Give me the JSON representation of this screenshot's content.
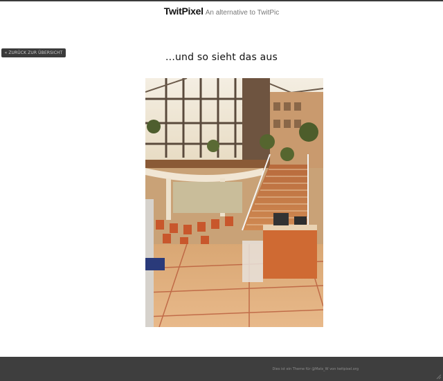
{
  "header": {
    "brand": "TwitPixel",
    "tagline": "An alternative to TwitPic"
  },
  "nav": {
    "back_label": "« ZURÜCK ZUR ÜBERSICHT"
  },
  "photo": {
    "title": "...und so sieht das aus"
  },
  "footer": {
    "credit": "Dies ist ein Theme für @Mats_W von twitpixel.org"
  },
  "colors": {
    "top_bar": "#3a3a3a",
    "footer_bg": "#3e3e3e",
    "button_bg": "#3b3b3b"
  }
}
